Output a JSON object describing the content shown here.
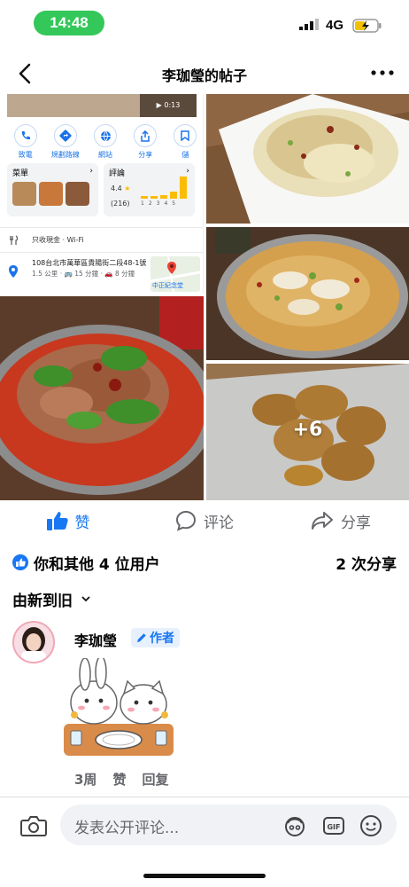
{
  "status": {
    "time": "14:48",
    "network": "4G"
  },
  "nav": {
    "title": "李珈瑩的帖子"
  },
  "map_card": {
    "video_time": "0:13",
    "actions": [
      {
        "label": "致電",
        "icon": "phone-icon"
      },
      {
        "label": "規劃路線",
        "icon": "directions-icon"
      },
      {
        "label": "網站",
        "icon": "globe-icon"
      },
      {
        "label": "分享",
        "icon": "share-icon"
      },
      {
        "label": "儲",
        "icon": "save-icon"
      }
    ],
    "menu_label": "菜單",
    "reviews_label": "評論",
    "rating": "4.4",
    "review_count": "(216)",
    "rating_bars": [
      0.1,
      0.1,
      0.15,
      0.3,
      0.95
    ],
    "bar_numbers": "12345",
    "cash_note": "只收現金 · Wi-Fi",
    "address": "108台北市萬華區貴陽街二段48-1號",
    "distance": "1.5 公里",
    "bus": "15 分鐘",
    "car": "8 分鐘",
    "map_label": "中正紀念堂"
  },
  "photos": {
    "more_count": "+6"
  },
  "reactions": {
    "like": "赞",
    "comment": "评论",
    "share": "分享"
  },
  "summary": {
    "likes": "你和其他 4 位用户",
    "shares": "2 次分享"
  },
  "sort": {
    "label": "由新到旧"
  },
  "comment": {
    "author": "李珈瑩",
    "badge": "作者",
    "age": "3周",
    "like": "赞",
    "reply": "回复"
  },
  "composer": {
    "placeholder": "发表公开评论..."
  },
  "colors": {
    "brand": "#1877f2",
    "status_green": "#34c759"
  }
}
